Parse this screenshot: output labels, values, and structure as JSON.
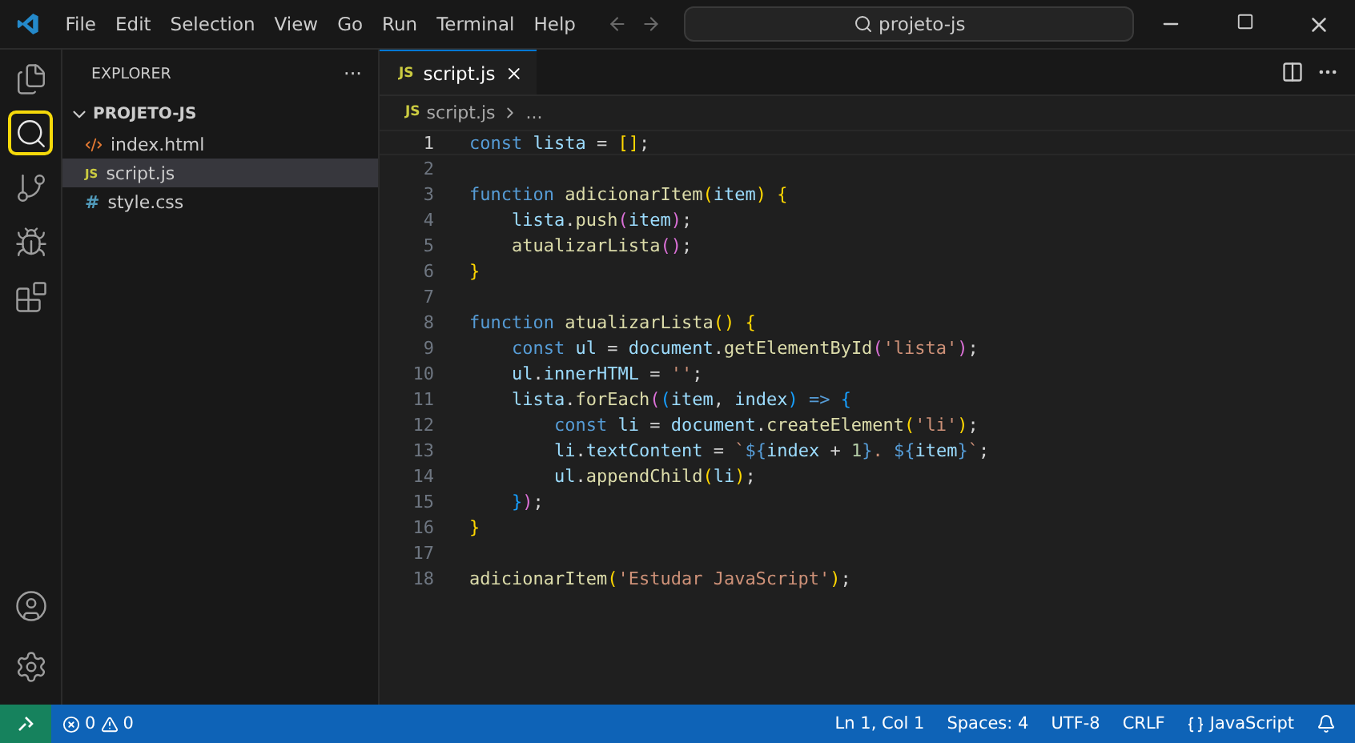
{
  "menu": [
    "File",
    "Edit",
    "Selection",
    "View",
    "Go",
    "Run",
    "Terminal",
    "Help"
  ],
  "command_center": {
    "text": "projeto-js"
  },
  "activity_bar": [
    {
      "kind": "files",
      "selected": false
    },
    {
      "kind": "search",
      "selected": true
    },
    {
      "kind": "source-control",
      "selected": false
    },
    {
      "kind": "run-debug",
      "selected": false
    },
    {
      "kind": "extensions",
      "selected": false
    }
  ],
  "activity_bar_bottom": [
    {
      "kind": "account"
    },
    {
      "kind": "settings"
    }
  ],
  "sidebar": {
    "title": "EXPLORER",
    "more": "···",
    "folder": "PROJETO-JS",
    "expanded": true,
    "files": [
      {
        "name": "index.html",
        "kind": "html",
        "selected": false
      },
      {
        "name": "script.js",
        "kind": "js",
        "icon": "JS",
        "selected": true
      },
      {
        "name": "style.css",
        "kind": "css",
        "icon": "#",
        "selected": false
      }
    ]
  },
  "tabs": [
    {
      "name": "script.js",
      "badge": "JS",
      "selected": true
    }
  ],
  "breadcrumb": {
    "badge": "JS",
    "file": "script.js",
    "rest": "..."
  },
  "code": [
    {
      "number": "1",
      "selected": true,
      "tokens": [
        {
          "t": "const ",
          "kind": "kw"
        },
        {
          "t": "lista",
          "kind": "var"
        },
        {
          "t": " = ",
          "kind": "p"
        },
        {
          "t": "[]",
          "kind": "b1"
        },
        {
          "t": ";",
          "kind": "p"
        }
      ]
    },
    {
      "number": "2",
      "selected": false
    },
    {
      "number": "3",
      "selected": false,
      "tokens": [
        {
          "t": "function ",
          "kind": "kw"
        },
        {
          "t": "adicionarItem",
          "kind": "fn"
        },
        {
          "t": "(",
          "kind": "b1"
        },
        {
          "t": "item",
          "kind": "var"
        },
        {
          "t": ")",
          "kind": "b1"
        },
        {
          "t": " {",
          "kind": "b1"
        }
      ]
    },
    {
      "number": "4",
      "selected": false,
      "tokens": [
        {
          "t": "    lista",
          "kind": "var"
        },
        {
          "t": ".",
          "kind": "p"
        },
        {
          "t": "push",
          "kind": "fn"
        },
        {
          "t": "(",
          "kind": "b2"
        },
        {
          "t": "item",
          "kind": "var"
        },
        {
          "t": ")",
          "kind": "b2"
        },
        {
          "t": ";",
          "kind": "p"
        }
      ]
    },
    {
      "number": "5",
      "selected": false,
      "tokens": [
        {
          "t": "    atualizarLista",
          "kind": "fn"
        },
        {
          "t": "()",
          "kind": "b2"
        },
        {
          "t": ";",
          "kind": "p"
        }
      ]
    },
    {
      "number": "6",
      "selected": false,
      "tokens": [
        {
          "t": "}",
          "kind": "b1"
        }
      ]
    },
    {
      "number": "7",
      "selected": false
    },
    {
      "number": "8",
      "selected": false,
      "tokens": [
        {
          "t": "function ",
          "kind": "kw"
        },
        {
          "t": "atualizarLista",
          "kind": "fn"
        },
        {
          "t": "()",
          "kind": "b1"
        },
        {
          "t": " {",
          "kind": "b1"
        }
      ]
    },
    {
      "number": "9",
      "selected": false,
      "tokens": [
        {
          "t": "    const ",
          "kind": "kw"
        },
        {
          "t": "ul",
          "kind": "var"
        },
        {
          "t": " = ",
          "kind": "p"
        },
        {
          "t": "document",
          "kind": "var"
        },
        {
          "t": ".",
          "kind": "p"
        },
        {
          "t": "getElementById",
          "kind": "fn"
        },
        {
          "t": "(",
          "kind": "b2"
        },
        {
          "t": "'lista'",
          "kind": "str"
        },
        {
          "t": ")",
          "kind": "b2"
        },
        {
          "t": ";",
          "kind": "p"
        }
      ]
    },
    {
      "number": "10",
      "selected": false,
      "tokens": [
        {
          "t": "    ul",
          "kind": "var"
        },
        {
          "t": ".",
          "kind": "p"
        },
        {
          "t": "innerHTML",
          "kind": "var"
        },
        {
          "t": " = ",
          "kind": "p"
        },
        {
          "t": "''",
          "kind": "str"
        },
        {
          "t": ";",
          "kind": "p"
        }
      ]
    },
    {
      "number": "11",
      "selected": false,
      "tokens": [
        {
          "t": "    lista",
          "kind": "var"
        },
        {
          "t": ".",
          "kind": "p"
        },
        {
          "t": "forEach",
          "kind": "fn"
        },
        {
          "t": "(",
          "kind": "b2"
        },
        {
          "t": "(",
          "kind": "b3"
        },
        {
          "t": "item",
          "kind": "var"
        },
        {
          "t": ", ",
          "kind": "p"
        },
        {
          "t": "index",
          "kind": "var"
        },
        {
          "t": ")",
          "kind": "b3"
        },
        {
          "t": " => ",
          "kind": "kw"
        },
        {
          "t": "{",
          "kind": "b3"
        }
      ]
    },
    {
      "number": "12",
      "selected": false,
      "tokens": [
        {
          "t": "        const ",
          "kind": "kw"
        },
        {
          "t": "li",
          "kind": "var"
        },
        {
          "t": " = ",
          "kind": "p"
        },
        {
          "t": "document",
          "kind": "var"
        },
        {
          "t": ".",
          "kind": "p"
        },
        {
          "t": "createElement",
          "kind": "fn"
        },
        {
          "t": "(",
          "kind": "b1"
        },
        {
          "t": "'li'",
          "kind": "str"
        },
        {
          "t": ")",
          "kind": "b1"
        },
        {
          "t": ";",
          "kind": "p"
        }
      ]
    },
    {
      "number": "13",
      "selected": false,
      "tokens": [
        {
          "t": "        li",
          "kind": "var"
        },
        {
          "t": ".",
          "kind": "p"
        },
        {
          "t": "textContent",
          "kind": "var"
        },
        {
          "t": " = ",
          "kind": "p"
        },
        {
          "t": "`",
          "kind": "str"
        },
        {
          "t": "${",
          "kind": "kw"
        },
        {
          "t": "index",
          "kind": "var"
        },
        {
          "t": " + ",
          "kind": "p"
        },
        {
          "t": "1",
          "kind": "num"
        },
        {
          "t": "}",
          "kind": "kw"
        },
        {
          "t": ". ",
          "kind": "str"
        },
        {
          "t": "${",
          "kind": "kw"
        },
        {
          "t": "item",
          "kind": "var"
        },
        {
          "t": "}",
          "kind": "kw"
        },
        {
          "t": "`",
          "kind": "str"
        },
        {
          "t": ";",
          "kind": "p"
        }
      ]
    },
    {
      "number": "14",
      "selected": false,
      "tokens": [
        {
          "t": "        ul",
          "kind": "var"
        },
        {
          "t": ".",
          "kind": "p"
        },
        {
          "t": "appendChild",
          "kind": "fn"
        },
        {
          "t": "(",
          "kind": "b1"
        },
        {
          "t": "li",
          "kind": "var"
        },
        {
          "t": ")",
          "kind": "b1"
        },
        {
          "t": ";",
          "kind": "p"
        }
      ]
    },
    {
      "number": "15",
      "selected": false,
      "tokens": [
        {
          "t": "    }",
          "kind": "b3"
        },
        {
          "t": ")",
          "kind": "b2"
        },
        {
          "t": ";",
          "kind": "p"
        }
      ]
    },
    {
      "number": "16",
      "selected": false,
      "tokens": [
        {
          "t": "}",
          "kind": "b1"
        }
      ]
    },
    {
      "number": "17",
      "selected": false
    },
    {
      "number": "18",
      "selected": false,
      "tokens": [
        {
          "t": "adicionarItem",
          "kind": "fn"
        },
        {
          "t": "(",
          "kind": "b1"
        },
        {
          "t": "'Estudar JavaScript'",
          "kind": "str"
        },
        {
          "t": ")",
          "kind": "b1"
        },
        {
          "t": ";",
          "kind": "p"
        }
      ]
    }
  ],
  "status_bar": {
    "errors": "0",
    "warnings": "0",
    "items": [
      "Ln 1, Col 1",
      "Spaces: 4",
      "UTF-8",
      "CRLF"
    ],
    "language": "JavaScript"
  }
}
